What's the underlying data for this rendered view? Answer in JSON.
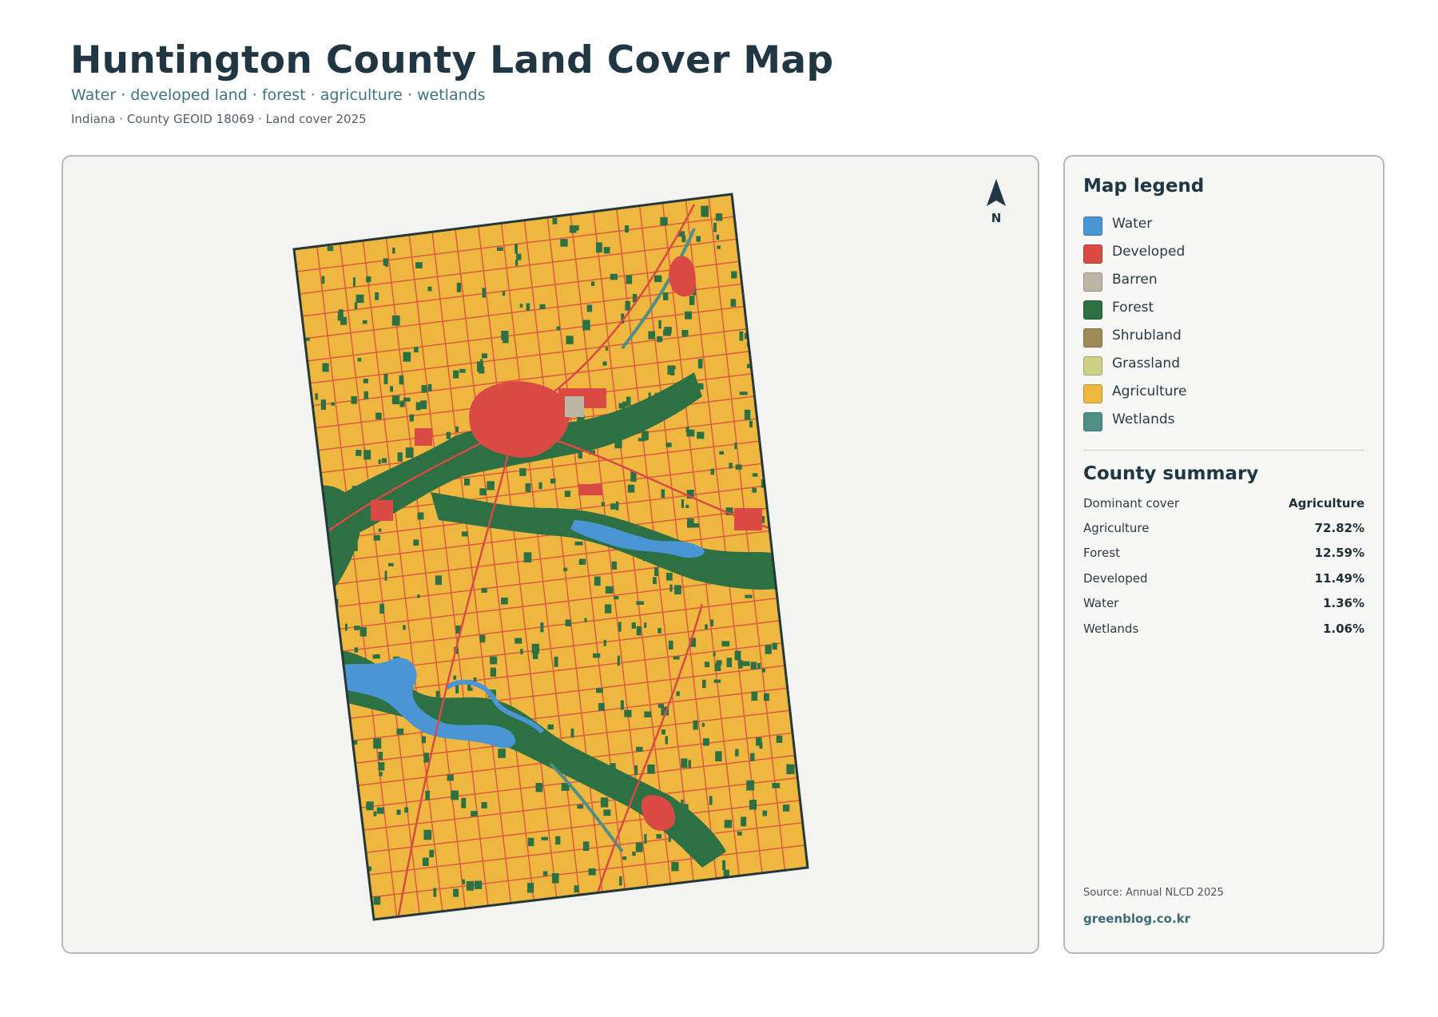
{
  "header": {
    "title": "Huntington County Land Cover Map",
    "subtitle": "Water · developed land · forest · agriculture · wetlands",
    "meta": "Indiana · County GEOID 18069 · Land cover 2025"
  },
  "map": {
    "north_label": "N",
    "colors": {
      "water": "#4a96d4",
      "developed": "#d94a44",
      "barren": "#bdb6a6",
      "forest": "#2c7043",
      "shrubland": "#a08a55",
      "grassland": "#cdd084",
      "agriculture": "#eeb840",
      "wetlands": "#4e8f86",
      "border": "#243838"
    }
  },
  "legend": {
    "title": "Map legend",
    "items": [
      {
        "label": "Water",
        "color": "#4a96d4"
      },
      {
        "label": "Developed",
        "color": "#d94a44"
      },
      {
        "label": "Barren",
        "color": "#bdb6a6"
      },
      {
        "label": "Forest",
        "color": "#2c7043"
      },
      {
        "label": "Shrubland",
        "color": "#a08a55"
      },
      {
        "label": "Grassland",
        "color": "#cdd084"
      },
      {
        "label": "Agriculture",
        "color": "#eeb840"
      },
      {
        "label": "Wetlands",
        "color": "#4e8f86"
      }
    ]
  },
  "summary": {
    "title": "County summary",
    "rows": [
      {
        "label": "Dominant cover",
        "value": "Agriculture"
      },
      {
        "label": "Agriculture",
        "value": "72.82%"
      },
      {
        "label": "Forest",
        "value": "12.59%"
      },
      {
        "label": "Developed",
        "value": "11.49%"
      },
      {
        "label": "Water",
        "value": "1.36%"
      },
      {
        "label": "Wetlands",
        "value": "1.06%"
      }
    ]
  },
  "footer": {
    "source": "Source: Annual NLCD 2025",
    "credit": "greenblog.co.kr"
  }
}
